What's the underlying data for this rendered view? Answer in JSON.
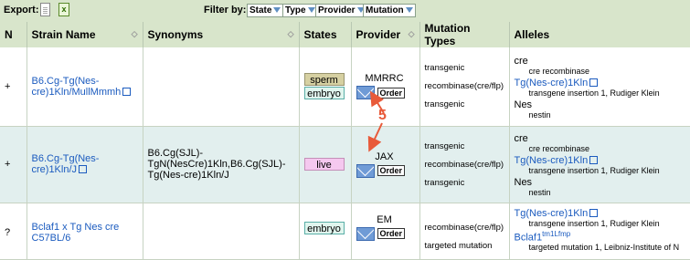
{
  "toolbar": {
    "export_label": "Export:",
    "filter_label": "Filter by:",
    "filters": [
      "State",
      "Type",
      "Provider",
      "Mutation"
    ]
  },
  "columns": [
    "N",
    "Strain Name",
    "Synonyms",
    "States",
    "Provider",
    "Mutation Types",
    "Alleles"
  ],
  "rows": [
    {
      "n": "+",
      "strain": "B6.Cg-Tg(Nes-cre)1Kln/MullMmmh",
      "synonyms": "",
      "states": [
        "sperm",
        "embryo"
      ],
      "provider": "MMRRC",
      "order_label": "Order",
      "mutation_types": [
        "transgenic",
        "recombinase(cre/flp)",
        "transgenic"
      ],
      "alleles": [
        {
          "head": "cre",
          "sub": "cre recombinase"
        },
        {
          "head": "Tg(Nes-cre)1Kln",
          "sub": "transgene insertion 1, Rudiger Klein"
        },
        {
          "head": "Nes",
          "sub": "nestin"
        }
      ]
    },
    {
      "n": "+",
      "strain": "B6.Cg-Tg(Nes-cre)1Kln/J",
      "synonyms": "B6.Cg(SJL)-TgN(NesCre)1Kln,B6.Cg(SJL)-Tg(Nes-cre)1Kln/J",
      "states": [
        "live"
      ],
      "provider": "JAX",
      "order_label": "Order",
      "mutation_types": [
        "transgenic",
        "recombinase(cre/flp)",
        "transgenic"
      ],
      "alleles": [
        {
          "head": "cre",
          "sub": "cre recombinase"
        },
        {
          "head": "Tg(Nes-cre)1Kln",
          "sub": "transgene insertion 1, Rudiger Klein"
        },
        {
          "head": "Nes",
          "sub": "nestin"
        }
      ]
    },
    {
      "n": "?",
      "strain": "Bclaf1 x Tg Nes cre C57BL/6",
      "synonyms": "",
      "states": [
        "embryo"
      ],
      "provider": "EM",
      "order_label": "Order",
      "mutation_types": [
        "recombinase(cre/flp)",
        "targeted mutation"
      ],
      "alleles": [
        {
          "head": "Tg(Nes-cre)1Kln",
          "sub": "transgene insertion 1, Rudiger Klein"
        },
        {
          "head": "Bclaf1",
          "sup": "tm1Lfmp",
          "sub": "targeted mutation 1, Leibniz-Institute of N"
        }
      ]
    }
  ],
  "annotation": {
    "label": "5",
    "color": "#e85a3a"
  }
}
